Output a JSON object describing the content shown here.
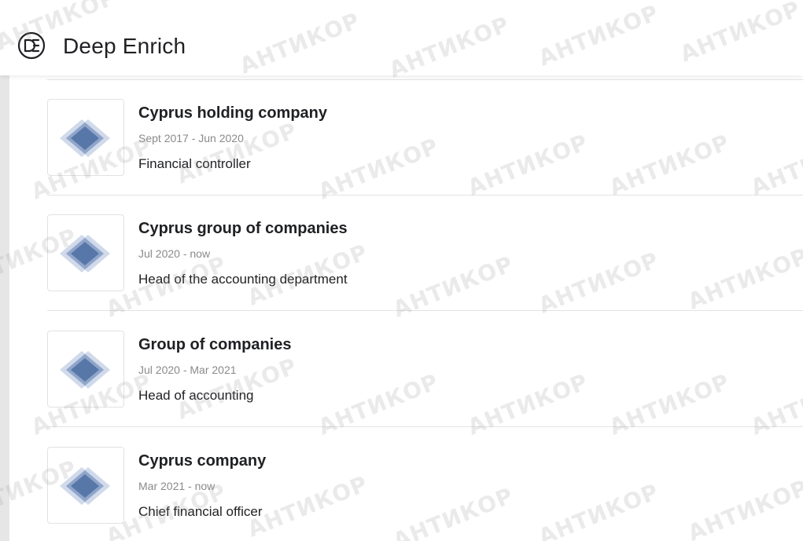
{
  "header": {
    "brand": "Deep Enrich",
    "logo_icon": "deep-enrich-logo-icon"
  },
  "experience": [
    {
      "company": "Cyprus holding company",
      "dates": "Sept 2017 - Jun 2020",
      "position": "Financial controller",
      "logo_icon": "diamond-logo-icon"
    },
    {
      "company": "Cyprus group of companies",
      "dates": "Jul 2020 - now",
      "position": "Head of the accounting department",
      "logo_icon": "diamond-logo-icon"
    },
    {
      "company": "Group of companies",
      "dates": "Jul 2020 - Mar 2021",
      "position": "Head of accounting",
      "logo_icon": "diamond-logo-icon"
    },
    {
      "company": "Cyprus company",
      "dates": "Mar 2021 - now",
      "position": "Chief financial officer",
      "logo_icon": "diamond-logo-icon"
    }
  ],
  "watermark": {
    "text": "АНТИКОР"
  },
  "colors": {
    "logo_diamond_dark": "#4f6fa3",
    "logo_diamond_light": "#a9bbd9",
    "divider": "#e3e3e3",
    "date_text": "#8a8a8a",
    "left_rail": "#e6e6e6"
  }
}
